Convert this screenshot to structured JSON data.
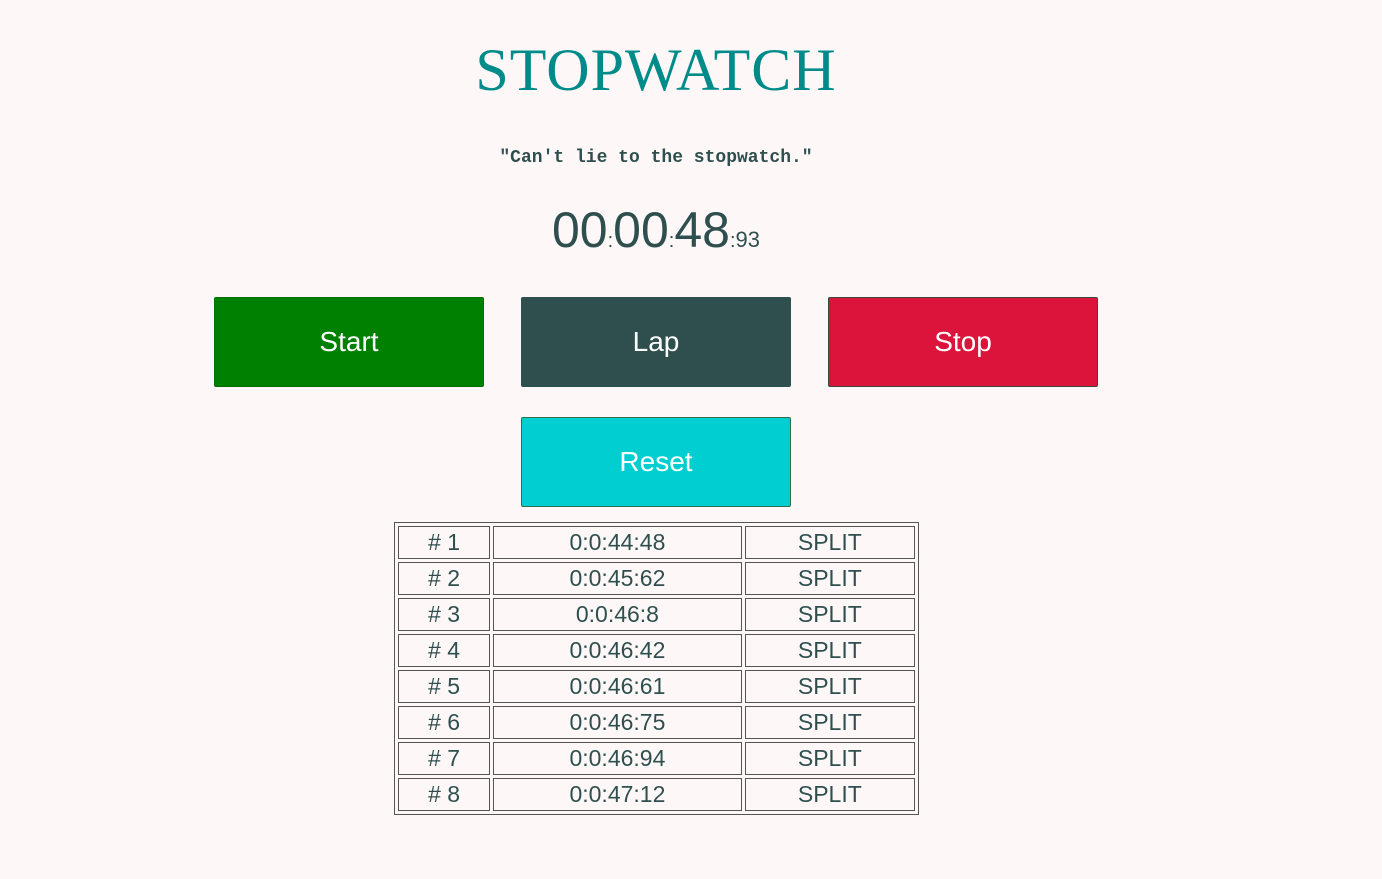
{
  "header": {
    "title": "STOPWATCH",
    "quote": "\"Can't lie to the stopwatch.\""
  },
  "clock": {
    "hours": "00",
    "sep1": ":",
    "minutes": "00",
    "sep2": ":",
    "seconds": "48",
    "sep3": ":",
    "centiseconds": "93"
  },
  "controls": {
    "start_label": "Start",
    "lap_label": "Lap",
    "stop_label": "Stop",
    "reset_label": "Reset"
  },
  "colors": {
    "title": "#008b8b",
    "text": "#2f4f4f",
    "start": "#008000",
    "lap": "#2f4f4f",
    "stop": "#dc143c",
    "reset": "#00ced1",
    "background": "#fdf8f7"
  },
  "laps": [
    {
      "number": "# 1",
      "time": "0:0:44:48",
      "type": "SPLIT"
    },
    {
      "number": "# 2",
      "time": "0:0:45:62",
      "type": "SPLIT"
    },
    {
      "number": "# 3",
      "time": "0:0:46:8",
      "type": "SPLIT"
    },
    {
      "number": "# 4",
      "time": "0:0:46:42",
      "type": "SPLIT"
    },
    {
      "number": "# 5",
      "time": "0:0:46:61",
      "type": "SPLIT"
    },
    {
      "number": "# 6",
      "time": "0:0:46:75",
      "type": "SPLIT"
    },
    {
      "number": "# 7",
      "time": "0:0:46:94",
      "type": "SPLIT"
    },
    {
      "number": "# 8",
      "time": "0:0:47:12",
      "type": "SPLIT"
    }
  ]
}
